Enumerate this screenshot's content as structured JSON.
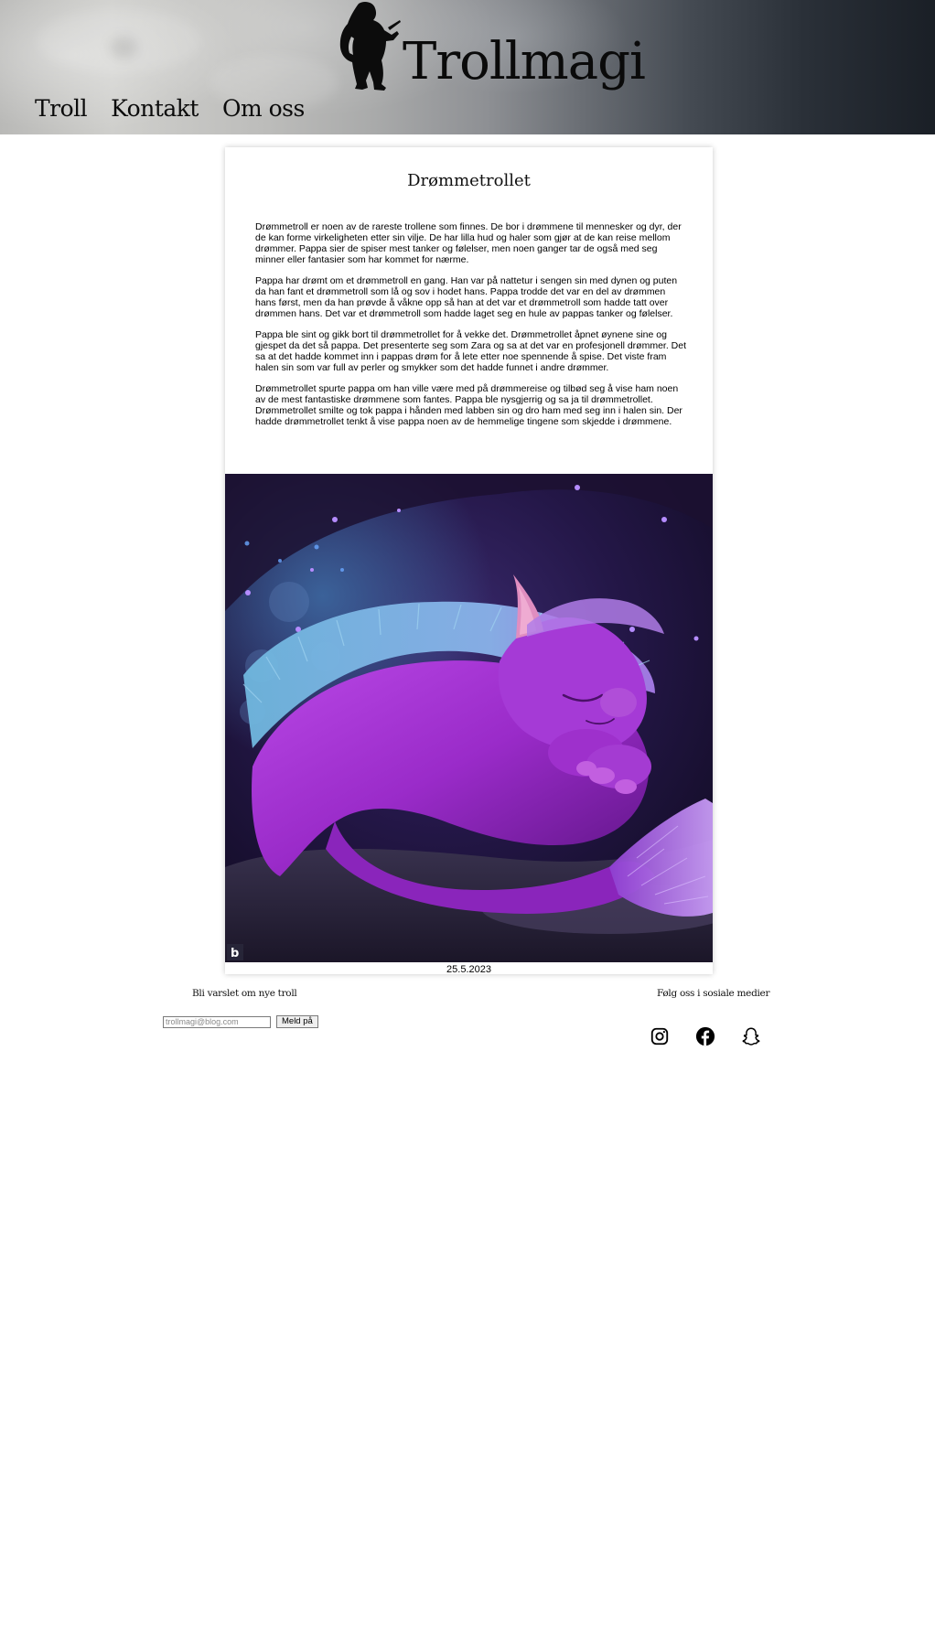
{
  "header": {
    "nav": [
      {
        "label": "Troll"
      },
      {
        "label": "Kontakt"
      },
      {
        "label": "Om oss"
      }
    ],
    "logo_text": "Trollmagi"
  },
  "article": {
    "title": "Drømmetrollet",
    "paragraphs": [
      "Drømmetroll er noen av de rareste trollene som finnes. De bor i drømmene til mennesker og dyr, der de kan forme virkeligheten etter sin vilje. De har lilla hud og haler som gjør at de kan reise mellom drømmer. Pappa sier de spiser mest tanker og følelser, men noen ganger tar de også med seg minner eller fantasier som har kommet for nærme.",
      "Pappa har drømt om et drømmetroll en gang. Han var på nattetur i sengen sin med dynen og puten da han fant et drømmetroll som lå og sov i hodet hans. Pappa trodde det var en del av drømmen hans først, men da han prøvde å våkne opp så han at det var et drømmetroll som hadde tatt over drømmen hans. Det var et drømmetroll som hadde laget seg en hule av pappas tanker og følelser.",
      "Pappa ble sint og gikk bort til drømmetrollet for å vekke det. Drømmetrollet åpnet øynene sine og gjespet da det så pappa. Det presenterte seg som Zara og sa at det var en profesjonell drømmer. Det sa at det hadde kommet inn i pappas drøm for å lete etter noe spennende å spise. Det viste fram halen sin som var full av perler og smykker som det hadde funnet i andre drømmer.",
      "Drømmetrollet spurte pappa om han ville være med på drømmereise og tilbød seg å vise ham noen av de mest fantastiske drømmene som fantes. Pappa ble nysgjerrig og sa ja til drømmetrollet. Drømmetrollet smilte og tok pappa i hånden med labben sin og dro ham med seg inn i halen sin. Der hadde drømmetrollet tenkt å vise pappa noen av de hemmelige tingene som skjedde i drømmene."
    ],
    "date": "25.5.2023"
  },
  "footer": {
    "subscribe_title": "Bli varslet om nye troll",
    "email_placeholder": "trollmagi@blog.com",
    "subscribe_button": "Meld på",
    "social_title": "Følg oss i sosiale medier",
    "social_icons": [
      "instagram-icon",
      "facebook-icon",
      "snapchat-icon"
    ]
  },
  "colors": {
    "troll_purple": "#a62fd6",
    "troll_fur_blue": "#7fc8e8",
    "cave_dark": "#1a0f2e"
  }
}
